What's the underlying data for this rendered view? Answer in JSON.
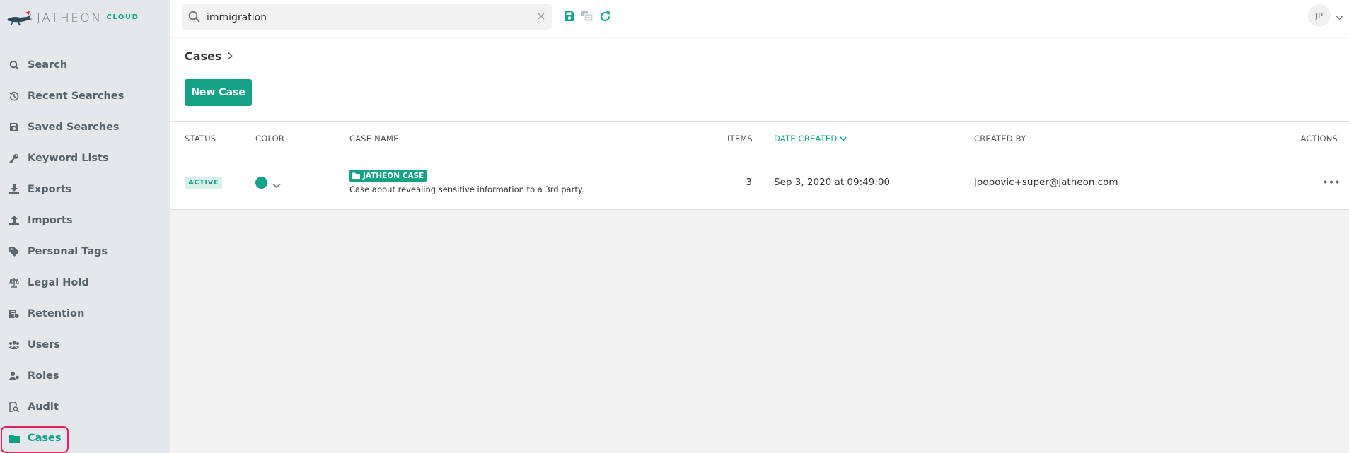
{
  "brand": {
    "name": "JATHEON",
    "suffix": "CLOUD",
    "accent_color": "#16a286",
    "logo_red": "#e3342f"
  },
  "sidebar": {
    "items": [
      {
        "label": "Search",
        "icon": "search-icon"
      },
      {
        "label": "Recent Searches",
        "icon": "history-icon"
      },
      {
        "label": "Saved Searches",
        "icon": "save-icon"
      },
      {
        "label": "Keyword Lists",
        "icon": "key-icon"
      },
      {
        "label": "Exports",
        "icon": "download-icon"
      },
      {
        "label": "Imports",
        "icon": "upload-icon"
      },
      {
        "label": "Personal Tags",
        "icon": "tag-icon"
      },
      {
        "label": "Legal Hold",
        "icon": "scale-icon"
      },
      {
        "label": "Retention",
        "icon": "retention-icon"
      },
      {
        "label": "Users",
        "icon": "users-icon"
      },
      {
        "label": "Roles",
        "icon": "roles-icon"
      },
      {
        "label": "Audit",
        "icon": "audit-icon"
      },
      {
        "label": "Cases",
        "icon": "folder-icon",
        "active": true
      }
    ]
  },
  "topbar": {
    "search_value": "immigration",
    "search_placeholder": "",
    "clear_glyph": "×",
    "user_initials": "JP"
  },
  "page": {
    "breadcrumb": "Cases",
    "new_button": "New Case"
  },
  "table": {
    "headers": {
      "status": "STATUS",
      "color": "COLOR",
      "case_name": "CASE NAME",
      "items": "ITEMS",
      "date_created": "DATE CREATED",
      "created_by": "CREATED BY",
      "actions": "ACTIONS"
    },
    "rows": [
      {
        "status": "ACTIVE",
        "color": "#16a286",
        "case_name": "JATHEON CASE",
        "description": "Case about revealing sensitive information to a 3rd party.",
        "items": "3",
        "date_created": "Sep 3, 2020 at 09:49:00",
        "created_by": "jpopovic+super@jatheon.com"
      }
    ]
  }
}
